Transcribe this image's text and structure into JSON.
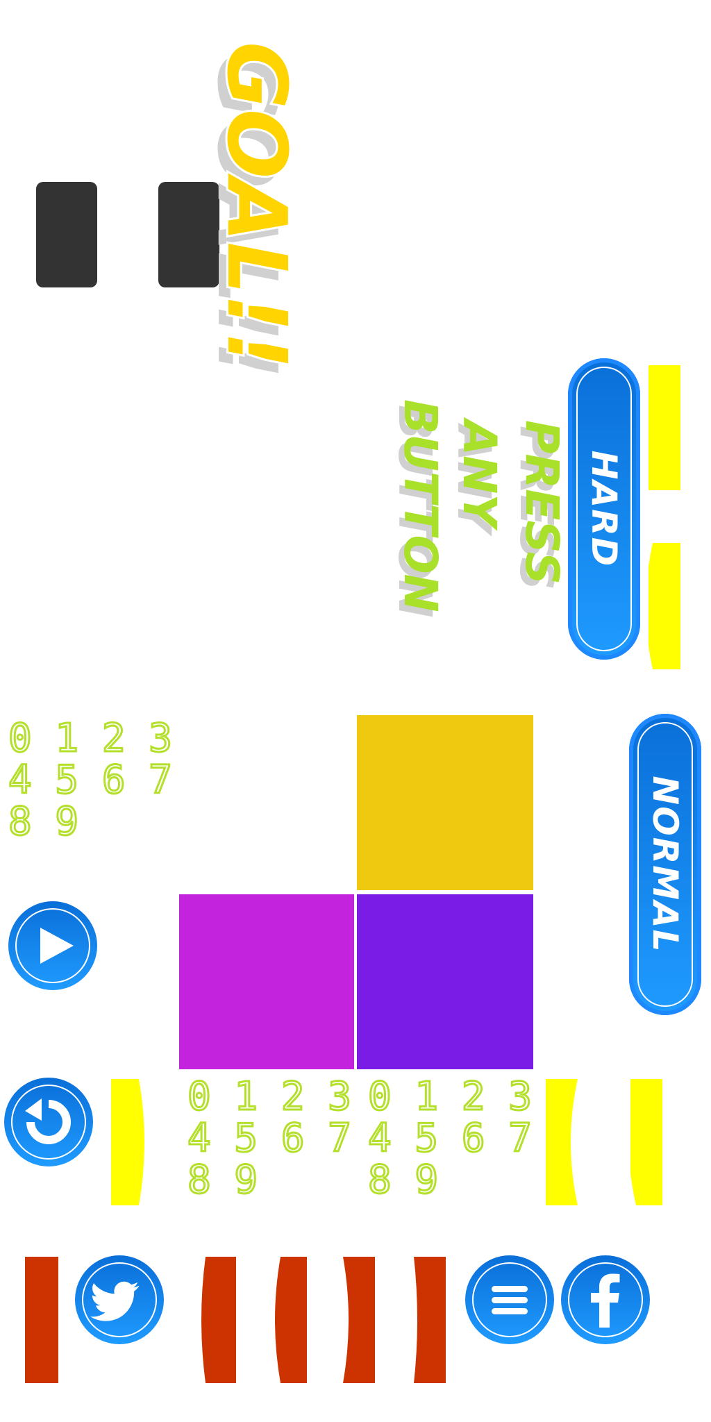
{
  "goal": {
    "text": "GOAL!!"
  },
  "prompt": {
    "line1": "PRESS",
    "line2": "ANY",
    "line3": "BUTTON"
  },
  "buttons": {
    "hard_label": "HARD",
    "normal_label": "NORMAL"
  },
  "digit_strip": {
    "row1": "0 1 2 3",
    "row2": "4 5 6 7",
    "row3": "8 9"
  },
  "icons": {
    "pause": "pause-icon",
    "play": "play-icon",
    "restart": "restart-icon",
    "twitter": "twitter-icon",
    "menu": "menu-icon",
    "facebook": "facebook-icon"
  },
  "colors": {
    "goal_yellow": "#ffd400",
    "prompt_green": "#a8e02a",
    "button_blue": "#1e88ff",
    "block_yellow": "#eec90f",
    "block_magenta": "#c423dd",
    "block_purple": "#7a1ce6",
    "bar_yellow": "#ffff00",
    "bar_red": "#cc3300",
    "pause_gray": "#333333"
  }
}
